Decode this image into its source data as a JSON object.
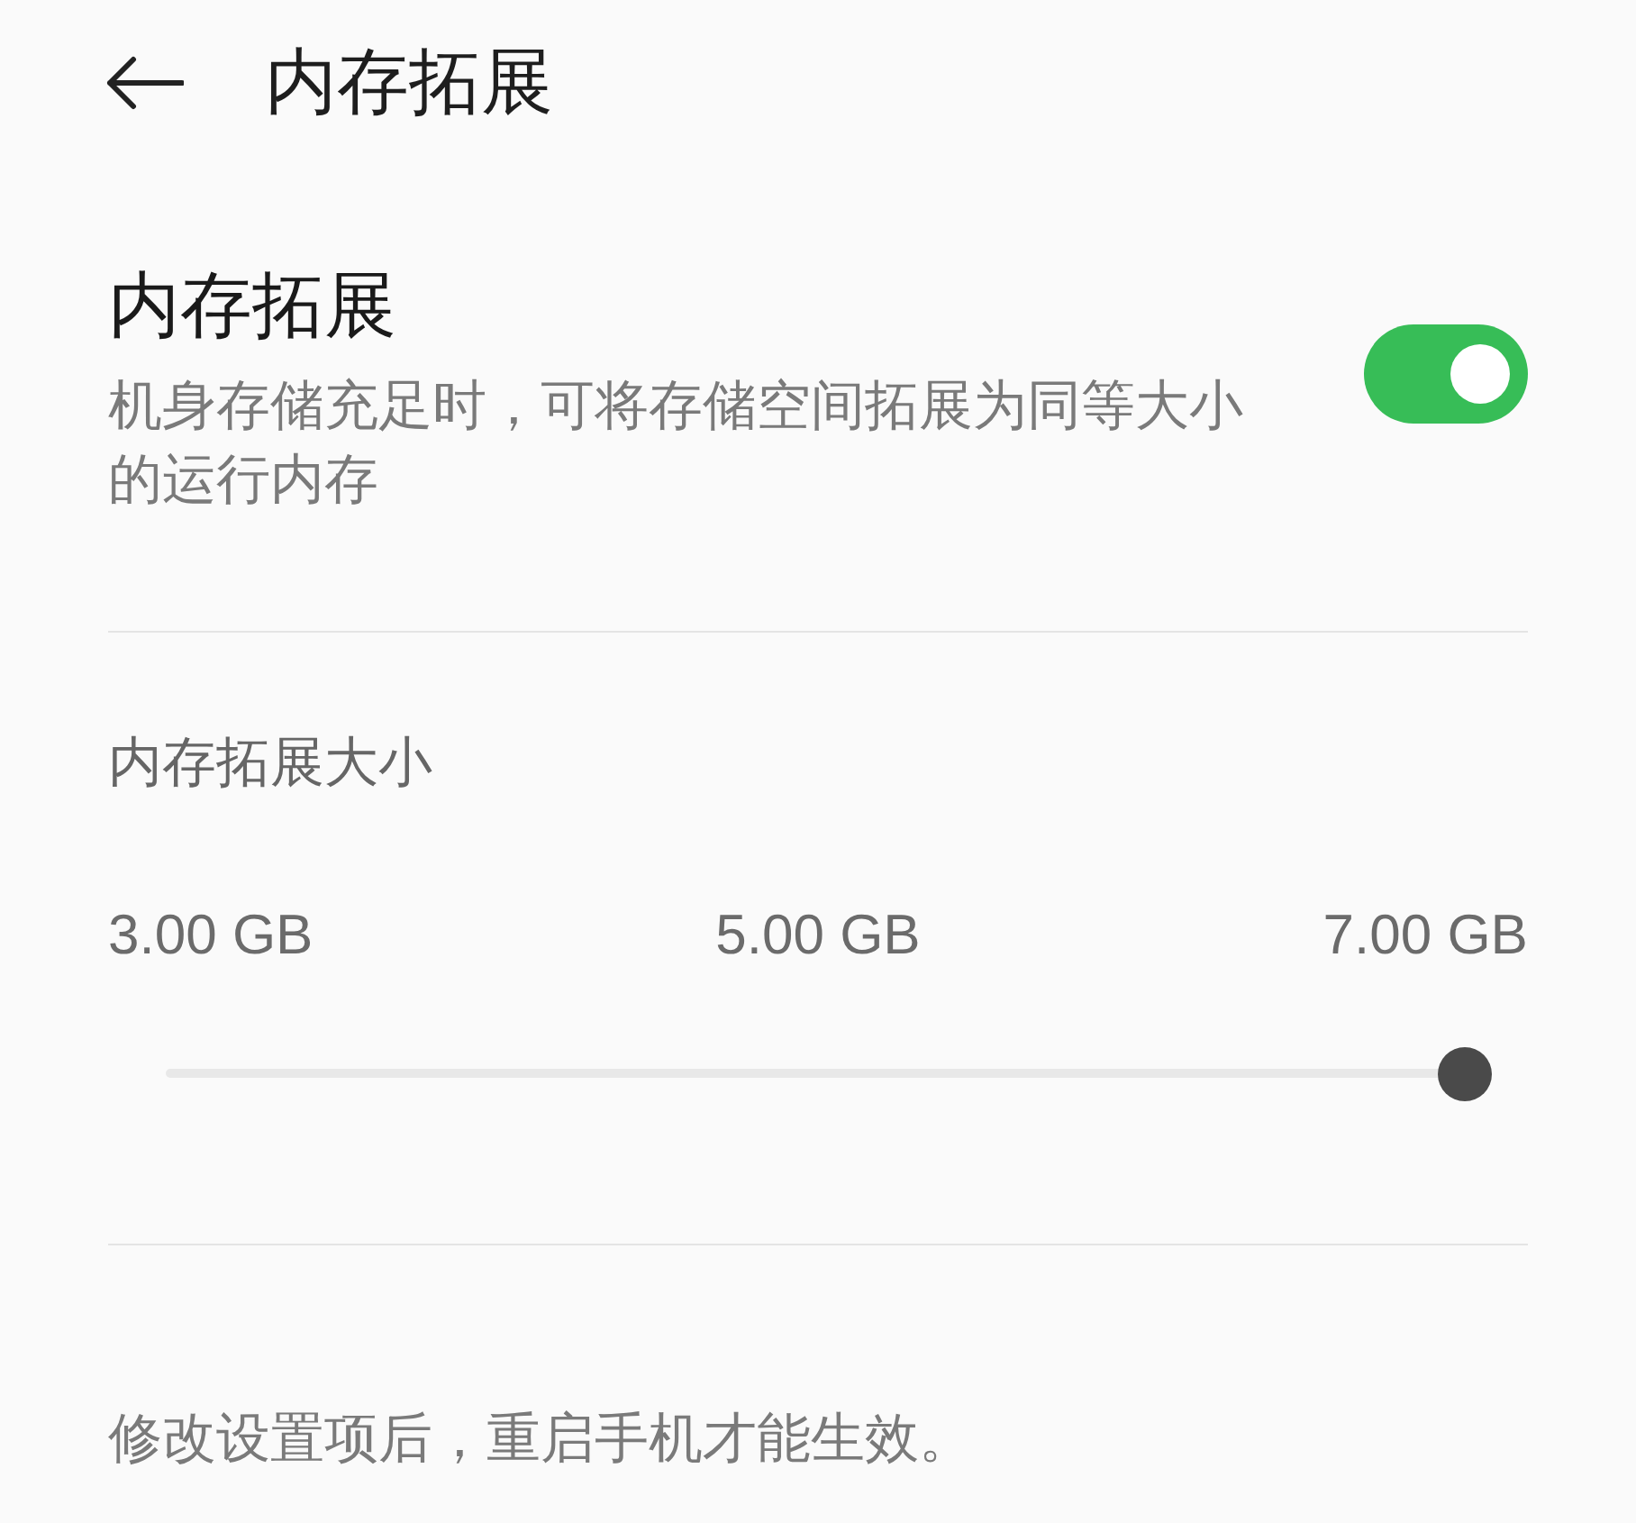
{
  "header": {
    "title": "内存拓展"
  },
  "memory_extension": {
    "title": "内存拓展",
    "description": "机身存储充足时，可将存储空间拓展为同等大小的运行内存",
    "on": true
  },
  "extension_size": {
    "label": "内存拓展大小",
    "ticks": [
      "3.00 GB",
      "5.00 GB",
      "7.00 GB"
    ],
    "level": 1
  },
  "note": "修改设置项后，重启手机才能生效。"
}
